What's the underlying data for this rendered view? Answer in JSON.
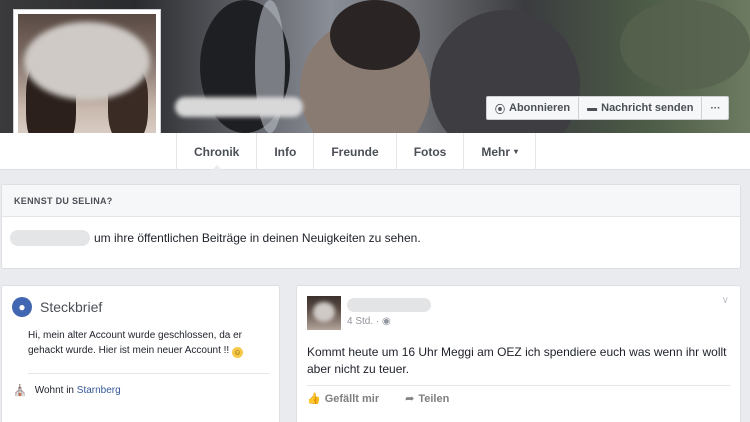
{
  "header": {
    "actions": [
      {
        "icon": "rss-icon",
        "glyph": "⦿",
        "label": "Abonnieren"
      },
      {
        "icon": "message-icon",
        "glyph": "▬",
        "label": "Nachricht senden"
      },
      {
        "icon": "more-icon",
        "glyph": "···",
        "label": ""
      }
    ]
  },
  "nav": {
    "tabs": [
      "Chronik",
      "Info",
      "Freunde",
      "Fotos",
      "Mehr"
    ],
    "more_caret": "▾"
  },
  "know_card": {
    "title": "KENNST DU SELINA?",
    "text": "um ihre öffentlichen Beiträge in deinen Neuigkeiten zu sehen."
  },
  "intro": {
    "title": "Steckbrief",
    "bio": "Hi, mein alter Account wurde geschlossen, da er gehackt wurde. Hier ist mein neuer Account !!",
    "lives_prefix": "Wohnt in",
    "lives_place": "Starnberg"
  },
  "post": {
    "time": "4 Std. · ",
    "text": "Kommt heute um 16 Uhr Meggi am OEZ ich spendiere euch was wenn ihr wollt aber nicht zu teuer.",
    "like_label": "Gefällt mir",
    "share_label": "Teilen"
  },
  "colors": {
    "accent": "#4267b2",
    "link": "#365899",
    "background": "#e9ebee"
  }
}
